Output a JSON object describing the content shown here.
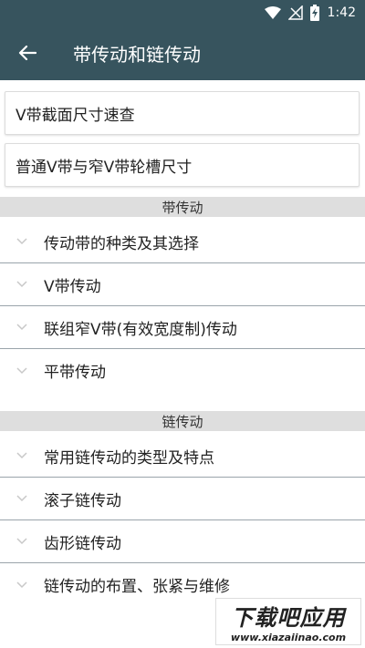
{
  "status_bar": {
    "time": "1:42",
    "icons": [
      "wifi-icon",
      "no-signal-icon",
      "battery-charging-icon"
    ]
  },
  "app_bar": {
    "back_icon": "arrow-back-icon",
    "title": "带传动和链传动"
  },
  "quick_cards": [
    {
      "label": "V带截面尺寸速查"
    },
    {
      "label": "普通V带与窄V带轮槽尺寸"
    }
  ],
  "sections": [
    {
      "header": "带传动",
      "items": [
        {
          "label": "传动带的种类及其选择"
        },
        {
          "label": "V带传动"
        },
        {
          "label": "联组窄V带(有效宽度制)传动"
        },
        {
          "label": "平带传动"
        }
      ]
    },
    {
      "header": "链传动",
      "items": [
        {
          "label": "常用链传动的类型及特点"
        },
        {
          "label": "滚子链传动"
        },
        {
          "label": "齿形链传动"
        },
        {
          "label": "链传动的布置、张紧与维修"
        }
      ]
    }
  ],
  "watermark": {
    "title": "下载吧应用",
    "url": "www.xiazaiinao.com"
  },
  "colors": {
    "app_bar": "#37545e",
    "section_header_bg": "#dedede",
    "divider": "#9aa4ab",
    "chevron": "#c8c8c8"
  }
}
